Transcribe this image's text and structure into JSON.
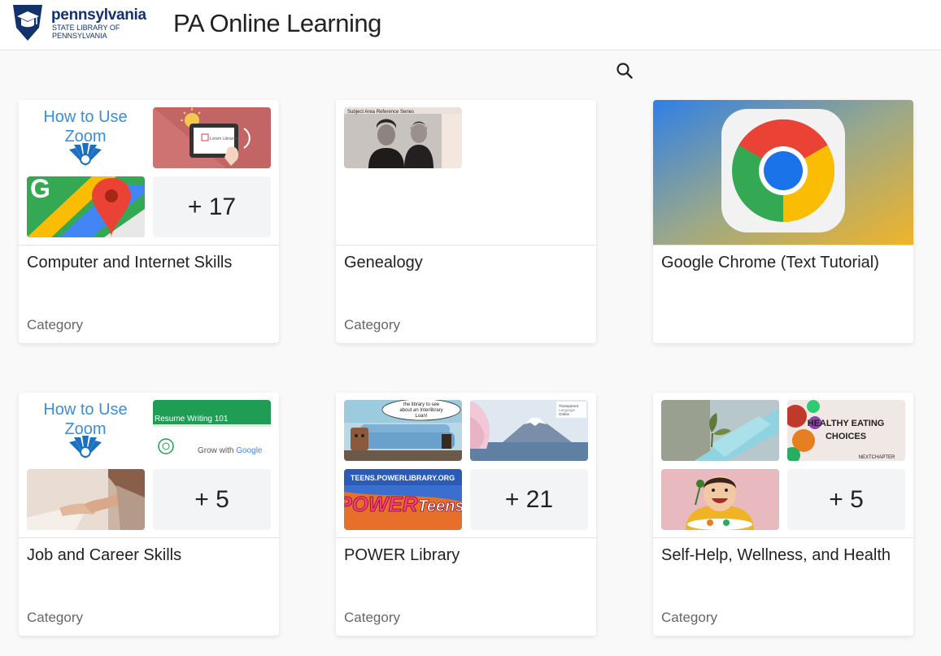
{
  "header": {
    "logo": {
      "wordmark": "pennsylvania",
      "subtitle_line1": "STATE LIBRARY OF",
      "subtitle_line2": "PENNSYLVANIA",
      "icon": "keystone-academic-cap-icon"
    },
    "title": "PA Online Learning"
  },
  "search": {
    "icon": "search-icon"
  },
  "cards": [
    {
      "title": "Computer and Internet Skills",
      "type_label": "Category",
      "more_count": "+ 17",
      "thumbs": [
        {
          "text_line1": "How to Use",
          "text_line2": "Zoom"
        },
        {
          "icon": "tablet-library-icon",
          "caption": "Lorem Libraries"
        },
        {
          "icon": "google-maps-icon",
          "letter": "G"
        }
      ]
    },
    {
      "title": "Genealogy",
      "type_label": "Category",
      "thumbs": [
        {
          "caption": "Subject Area Reference Series"
        }
      ]
    },
    {
      "title": "Google Chrome (Text Tutorial)",
      "type_label": "",
      "image": {
        "icon": "google-chrome-icon"
      }
    },
    {
      "title": "Job and Career Skills",
      "type_label": "Category",
      "more_count": "+ 5",
      "thumbs": [
        {
          "text_line1": "How to Use",
          "text_line2": "Zoom"
        },
        {
          "title": "Resume Writing 101",
          "brand_prefix": "Grow with ",
          "brand": "Google"
        },
        {
          "icon": "handshake-photo"
        }
      ]
    },
    {
      "title": "POWER Library",
      "type_label": "Category",
      "more_count": "+ 21",
      "thumbs": [
        {
          "bubble_line1": "the library to see",
          "bubble_line2": "about an Interlibrary",
          "bubble_line3": "Loan!"
        },
        {
          "badge_line1": "Transparent",
          "badge_line2": "Language",
          "badge_line3": "Online"
        },
        {
          "url": "TEENS.POWERLIBRARY.ORG",
          "brand_a": "POWER",
          "brand_b": "Teens"
        }
      ]
    },
    {
      "title": "Self-Help, Wellness, and Health",
      "type_label": "Category",
      "more_count": "+ 5",
      "thumbs": [
        {
          "icon": "sprout-photo"
        },
        {
          "line1": "HEALTHY EATING",
          "line2": "CHOICES",
          "footer": "NEXTCHAPTER"
        },
        {
          "icon": "child-eating-photo"
        }
      ]
    }
  ]
}
